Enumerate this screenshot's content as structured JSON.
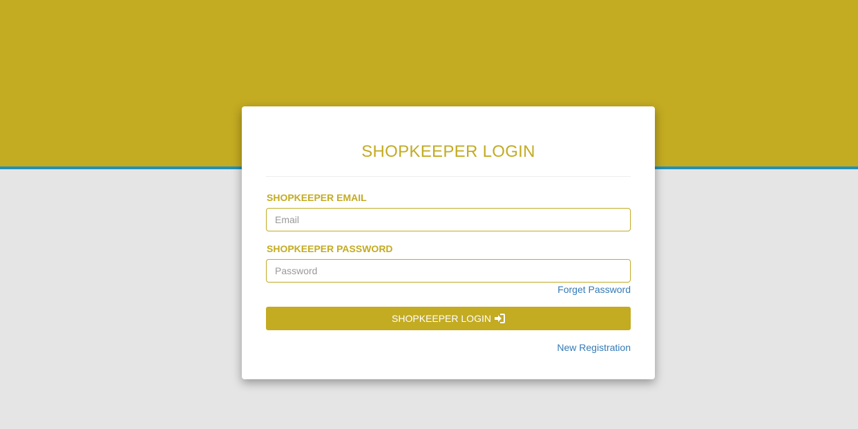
{
  "colors": {
    "accent": "#c3ab22",
    "top_band_border": "#1e8fc0",
    "background": "#e5e5e5",
    "link": "#337ab7"
  },
  "login_card": {
    "title": "SHOPKEEPER LOGIN",
    "email": {
      "label": "SHOPKEEPER EMAIL",
      "placeholder": "Email",
      "value": ""
    },
    "password": {
      "label": "SHOPKEEPER PASSWORD",
      "placeholder": "Password",
      "value": ""
    },
    "forget_password_link": "Forget Password",
    "login_button": {
      "label": "SHOPKEEPER LOGIN",
      "icon": "sign-in-icon"
    },
    "new_registration_link": "New Registration"
  }
}
